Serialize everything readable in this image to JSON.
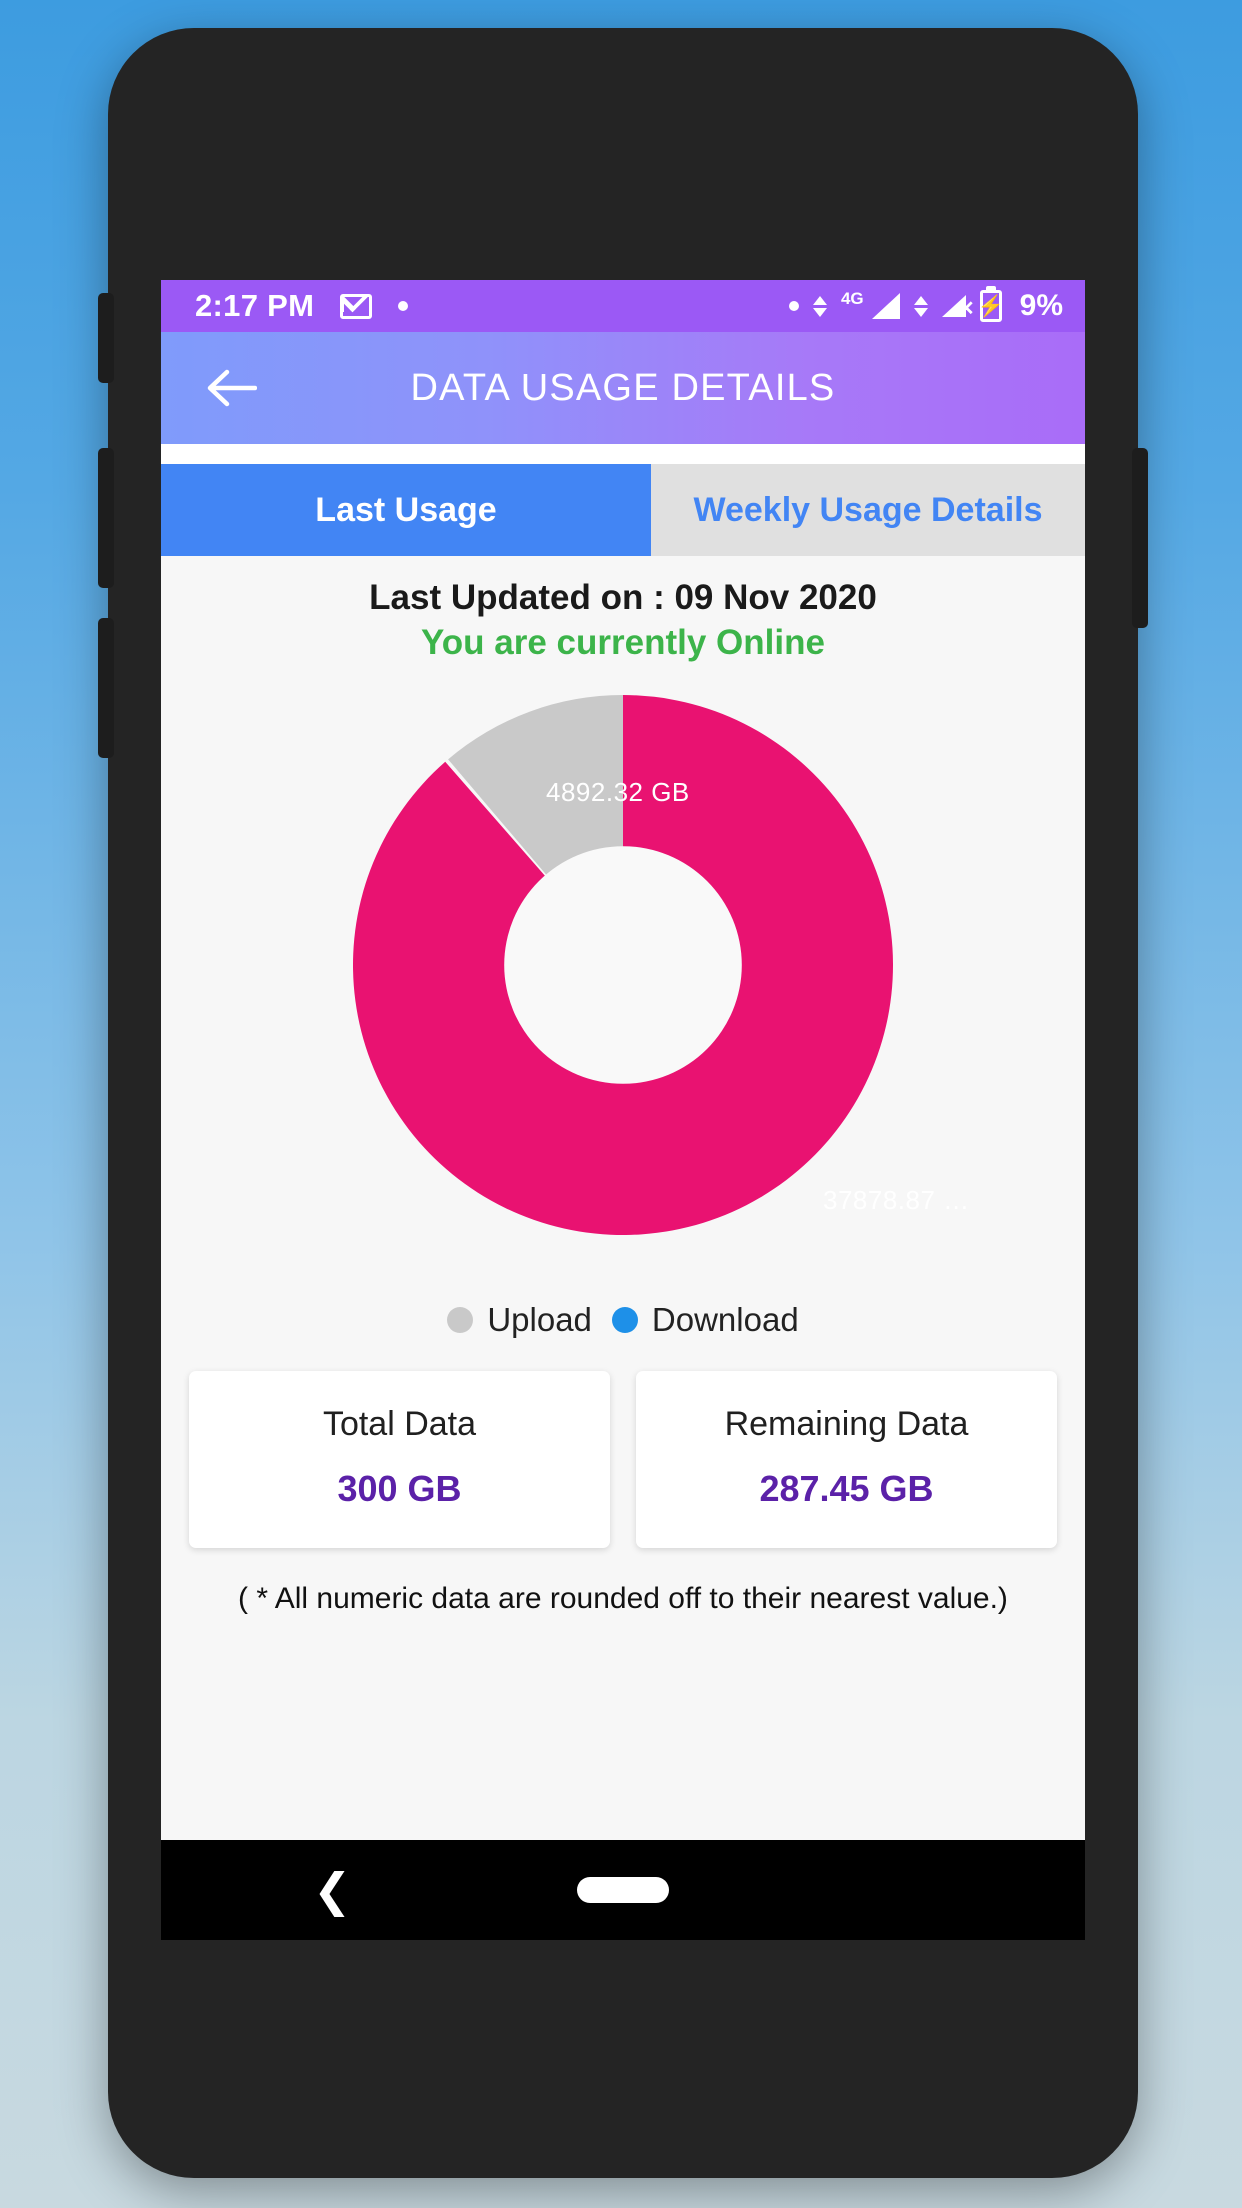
{
  "status_bar": {
    "time": "2:17 PM",
    "battery_percent": "9%",
    "network_type": "4G",
    "icons": [
      "gmail-icon",
      "notification-dot-icon",
      "data-arrows-icon",
      "signal-icon",
      "signal-no-service-icon",
      "battery-charging-icon"
    ]
  },
  "app_bar": {
    "title": "DATA USAGE DETAILS",
    "back_icon": "back-arrow-icon"
  },
  "tabs": [
    {
      "label": "Last Usage",
      "active": true
    },
    {
      "label": "Weekly Usage Details",
      "active": false
    }
  ],
  "header": {
    "last_updated": "Last Updated on : 09 Nov 2020",
    "online_status": "You are currently Online"
  },
  "cards": [
    {
      "title": "Total Data",
      "value": "300 GB"
    },
    {
      "title": "Remaining Data",
      "value": "287.45 GB"
    }
  ],
  "footnote": "( * All numeric data are rounded off to their nearest value.)",
  "nav_bar": {
    "back_icon": "nav-back-chevron-icon",
    "home_icon": "nav-home-pill-icon"
  },
  "colors": {
    "accent_purple": "#9b59f5",
    "tab_active_blue": "#4285f4",
    "online_green": "#3cb44a",
    "card_value_purple": "#5b21a8",
    "upload_gray": "#c9c9c9",
    "download_pink": "#e91271"
  },
  "chart_data": {
    "type": "pie",
    "title": "",
    "donut": true,
    "labels": [
      "Upload",
      "Download"
    ],
    "values": [
      4892.32,
      37878.87
    ],
    "unit": "GB",
    "data_labels": [
      "4892.32 GB",
      "37878.87 …"
    ],
    "colors": [
      "#c9c9c9",
      "#e91271"
    ],
    "legend": [
      {
        "label": "Upload",
        "color": "#c9c9c9"
      },
      {
        "label": "Download",
        "color": "#1e90e8"
      }
    ],
    "legend_position": "bottom",
    "start_angle_deg": 0,
    "direction": "counterclockwise-for-upload",
    "percentages": [
      11.44,
      88.56
    ]
  }
}
